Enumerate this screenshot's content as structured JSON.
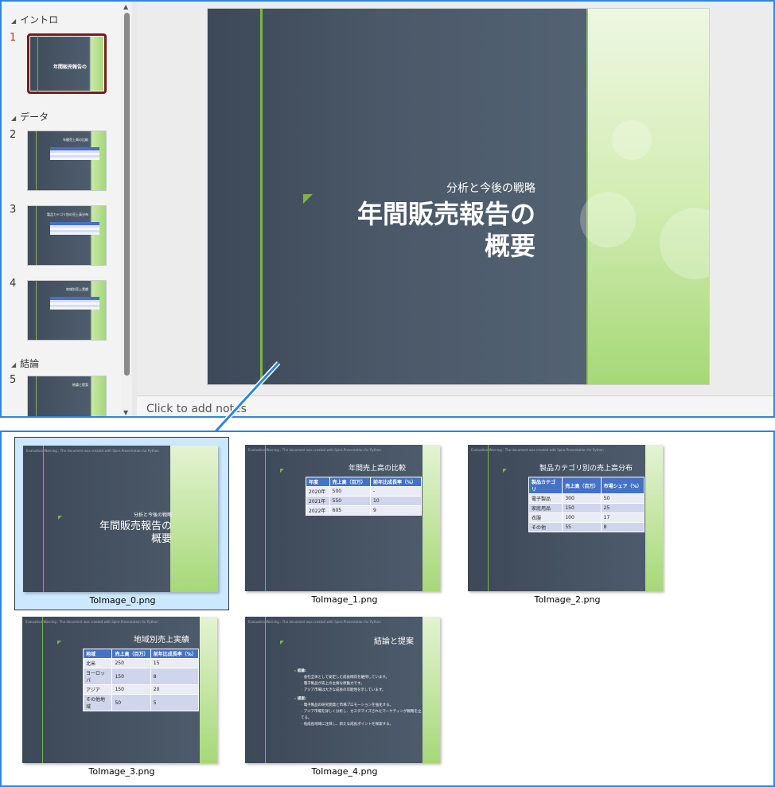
{
  "editor": {
    "sections": [
      "イントロ",
      "データ",
      "結論"
    ],
    "slide_numbers": [
      "1",
      "2",
      "3",
      "4",
      "5"
    ],
    "notes_placeholder": "Click to add notes"
  },
  "slide1": {
    "subtitle": "分析と今後の戦略",
    "title_line1": "年間販売報告の",
    "title_line2": "概要"
  },
  "watermark": "Evaluation Warning : The document was created with Spire.Presentation for Python",
  "slide2": {
    "title": "年間売上高の比較",
    "headers": [
      "年度",
      "売上高（百万）",
      "前年比成長率（%）"
    ],
    "rows": [
      [
        "2020年",
        "500",
        "-"
      ],
      [
        "2021年",
        "550",
        "10"
      ],
      [
        "2022年",
        "605",
        "9"
      ]
    ]
  },
  "slide3": {
    "title": "製品カテゴリ別の売上高分布",
    "headers": [
      "製品カテゴリ",
      "売上高（百万）",
      "市場シェア（%）"
    ],
    "rows": [
      [
        "電子製品",
        "300",
        "50"
      ],
      [
        "家庭用品",
        "150",
        "25"
      ],
      [
        "衣服",
        "100",
        "17"
      ],
      [
        "その他",
        "55",
        "8"
      ]
    ]
  },
  "slide4": {
    "title": "地域別売上実績",
    "headers": [
      "地域",
      "売上高（百万）",
      "前年比成長率（%）"
    ],
    "rows": [
      [
        "北米",
        "250",
        "15"
      ],
      [
        "ヨーロッパ",
        "150",
        "8"
      ],
      [
        "アジア",
        "150",
        "20"
      ],
      [
        "その他地域",
        "50",
        "5"
      ]
    ]
  },
  "slide5": {
    "title": "結論と提案",
    "heading1": "結論:",
    "items1": [
      "会社全体として安定した成長傾向を維持しています。",
      "電子製品が売上の主要な原動力です。",
      "アジア市場は大きな成長の可能性を示しています。"
    ],
    "heading2": "提案:",
    "items2": [
      "電子製品の研究開発と市場プロモーションを強化する。",
      "アジア市場を詳しく分析し、カスタマイズされたマーケティング戦略を立てる。",
      "低成長地域に注目し、新たな成長ポイントを探索する。"
    ]
  },
  "files": [
    "ToImage_0.png",
    "ToImage_1.png",
    "ToImage_2.png",
    "ToImage_3.png",
    "ToImage_4.png"
  ],
  "colors": {
    "accent_blue": "#2e86de",
    "slide_green": "#7ab648",
    "slide_dark": "#4a5868",
    "selected_thumb": "#7a1a1a"
  }
}
